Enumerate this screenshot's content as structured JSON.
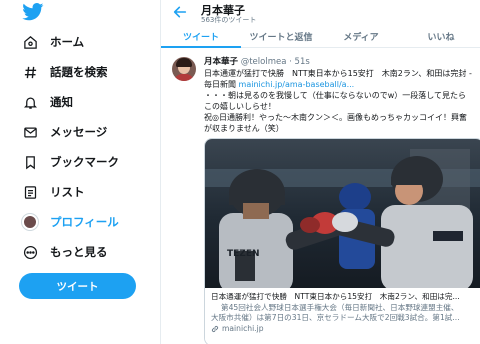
{
  "nav": {
    "items": [
      {
        "label": "ホーム",
        "icon": "home-icon"
      },
      {
        "label": "話題を検索",
        "icon": "hashtag-icon"
      },
      {
        "label": "通知",
        "icon": "bell-icon"
      },
      {
        "label": "メッセージ",
        "icon": "envelope-icon"
      },
      {
        "label": "ブックマーク",
        "icon": "bookmark-icon"
      },
      {
        "label": "リスト",
        "icon": "list-icon"
      },
      {
        "label": "プロフィール",
        "icon": "avatar"
      },
      {
        "label": "もっと見る",
        "icon": "more-icon"
      }
    ],
    "tweet_button": "ツイート"
  },
  "header": {
    "name": "月本華子",
    "tweet_count": "563件のツイート"
  },
  "tabs": [
    "ツイート",
    "ツイートと返信",
    "メディア",
    "いいね"
  ],
  "tweet": {
    "name": "月本華子",
    "handle": "@telolmea",
    "separator": "·",
    "time": "51s",
    "lines": [
      "日本通運が猛打で快勝　NTT東日本から15安打　木南2ラン、和田は完封 -",
      "毎日新聞 ",
      "・・・朝は見るのを我慢して（仕事にならないのでw）一段落して見たら",
      "この嬉しいしらせ！",
      "祝◎日通勝利！やった〜木南クン＞＜。画像もめっちゃカッコイイ！興奮",
      "が収まりません（笑）"
    ],
    "link": "mainichi.jp/ama-baseball/a..."
  },
  "card": {
    "title": "日本通運が猛打で快勝　NTT東日本から15安打　木南2ラン、和田は完...",
    "desc1": "第45回社会人野球日本選手権大会（毎日新聞社、日本野球連盟主催、",
    "desc2": "大阪市共催）は第7日の31日、京セラドーム大阪で2回戦3試合。第1試...",
    "domain": "mainichi.jp",
    "jersey_text": "TEZEN"
  },
  "colors": {
    "accent": "#1da1f2",
    "text": "#14171a",
    "muted": "#657786",
    "link": "#1b95e0"
  }
}
